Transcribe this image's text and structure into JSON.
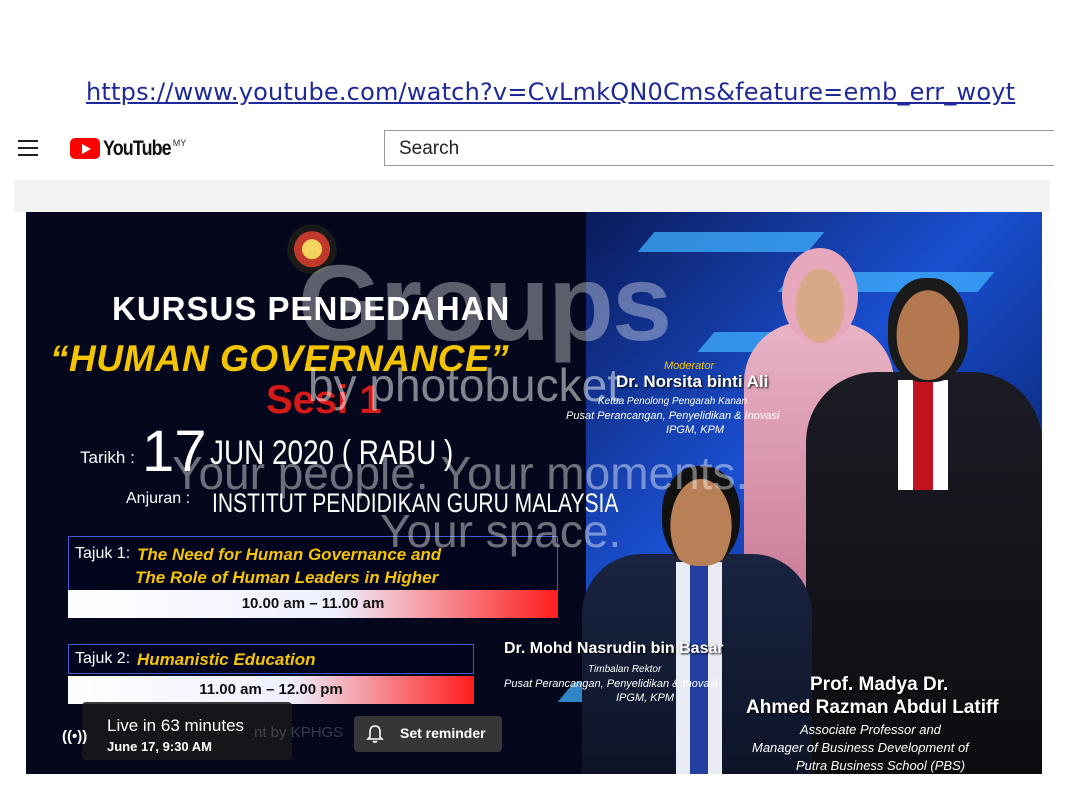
{
  "page": {
    "url": "https://www.youtube.com/watch?v=CvLmkQN0Cms&feature=emb_err_woyt"
  },
  "header": {
    "logo_text": "YouTube",
    "country_code": "MY",
    "search_placeholder": "Search",
    "icons": [
      "menu-icon",
      "youtube-play-icon"
    ]
  },
  "video": {
    "title_line1": "KURSUS PENDEDAHAN",
    "title_line2": "“HUMAN GOVERNANCE”",
    "session": "Sesi 1",
    "date_label": "Tarikh :",
    "date_day": "17",
    "date_rest": "JUN 2020 ( RABU )",
    "organizer_label": "Anjuran :",
    "organizer": "INSTITUT PENDIDIKAN GURU MALAYSIA",
    "topics": [
      {
        "label": "Tajuk 1:",
        "line1": "The Need for Human Governance and",
        "line2": "The Role of Human Leaders in Higher",
        "time": "10.00 am – 11.00 am"
      },
      {
        "label": "Tajuk 2:",
        "line1": "Humanistic Education",
        "time": "11.00 am – 12.00 pm"
      }
    ],
    "moderator": {
      "role": "Moderator",
      "name": "Dr. Norsita binti Ali",
      "title1": "Ketua Penolong Pengarah Kanan",
      "title2": "Pusat Perancangan, Penyelidikan & Inovasi",
      "title3": "IPGM, KPM"
    },
    "speaker1": {
      "name": "Dr. Mohd Nasrudin bin Basar",
      "title1": "Timbalan Rektor",
      "title2": "Pusat Perancangan, Penyelidikan & Inovasi",
      "title3": "IPGM, KPM"
    },
    "speaker2": {
      "name1": "Prof. Madya Dr.",
      "name2": "Ahmed Razman Abdul Latiff",
      "title1": "Associate Professor and",
      "title2": "Manager of Business Development of",
      "title3": "Putra Business School (PBS)"
    },
    "watermark": {
      "brand": "Groups",
      "by": "by photobucket",
      "line1": "Your people. Your moments.",
      "line2": "Your space."
    },
    "overlay": {
      "live_icon": "((•))",
      "live_title": "Live in 63 minutes",
      "live_when": "June 17, 9:30 AM",
      "faint_text": "nt by KPHGS",
      "reminder_label": "Set reminder"
    }
  }
}
